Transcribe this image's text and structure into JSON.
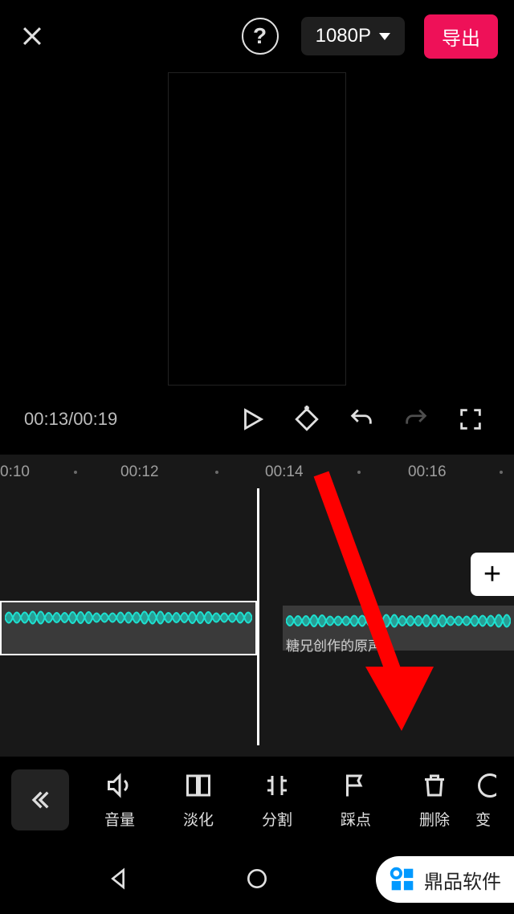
{
  "topbar": {
    "resolution": "1080P",
    "export_label": "导出"
  },
  "playbar": {
    "current_time": "00:13",
    "total_time": "00:19"
  },
  "ruler": {
    "ticks": [
      "0:10",
      "00:12",
      "00:14",
      "00:16"
    ]
  },
  "timeline": {
    "clip_label": "糖兄创作的原声",
    "add_label": "+"
  },
  "toolbar": {
    "items": [
      {
        "label": "音量",
        "icon": "volume"
      },
      {
        "label": "淡化",
        "icon": "fade"
      },
      {
        "label": "分割",
        "icon": "split"
      },
      {
        "label": "踩点",
        "icon": "beat"
      },
      {
        "label": "删除",
        "icon": "delete"
      },
      {
        "label": "变",
        "icon": "speed"
      }
    ]
  },
  "watermark": {
    "text": "鼎品软件"
  }
}
